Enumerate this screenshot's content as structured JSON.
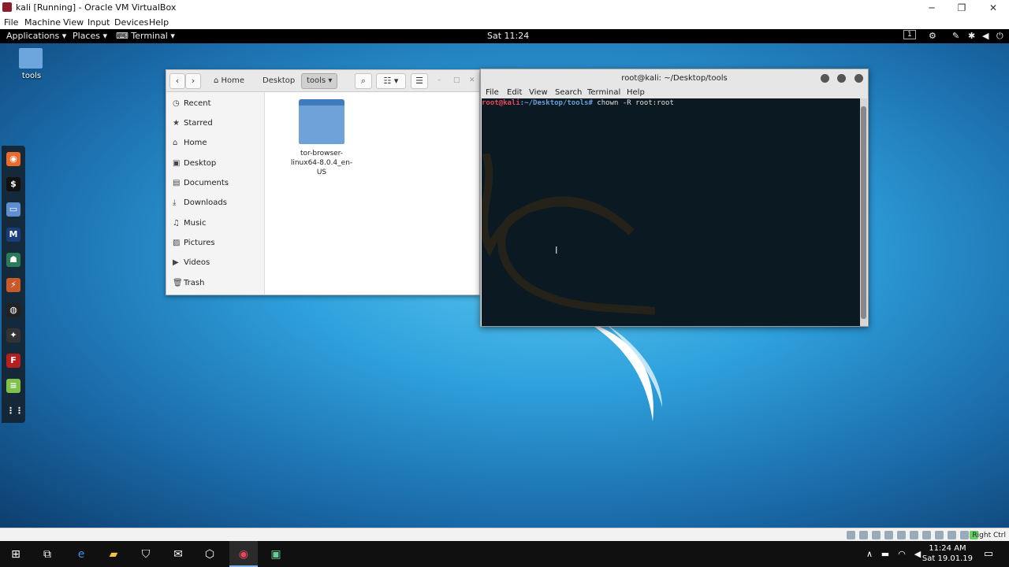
{
  "host": {
    "window_title": "kali [Running] - Oracle VM VirtualBox",
    "menu": [
      "File",
      "Machine",
      "View",
      "Input",
      "Devices",
      "Help"
    ],
    "status_right": "Right Ctrl"
  },
  "gnome": {
    "applications": "Applications",
    "places": "Places",
    "terminal": "Terminal",
    "clock": "Sat 11:24",
    "workspace": "1"
  },
  "desktop": {
    "icon_label": "tools"
  },
  "file_manager": {
    "breadcrumbs": [
      "Home",
      "Desktop",
      "tools"
    ],
    "sidebar": [
      "Recent",
      "Starred",
      "Home",
      "Desktop",
      "Documents",
      "Downloads",
      "Music",
      "Pictures",
      "Videos",
      "Trash"
    ],
    "file_label": "tor-browser-linux64-8.0.4_en-US"
  },
  "terminal": {
    "title": "root@kali: ~/Desktop/tools",
    "menu": [
      "File",
      "Edit",
      "View",
      "Search",
      "Terminal",
      "Help"
    ],
    "prompt_user": "root@kali",
    "prompt_path": ":~/Desktop/tools#",
    "command": " chown -R root:root"
  },
  "taskbar": {
    "time": "11:24 AM",
    "date": "Sat 19.01.19"
  },
  "colors": {
    "prompt_user": "#e8475b",
    "prompt_path": "#6a9fd8",
    "terminal_bg": "#0b1a22"
  }
}
